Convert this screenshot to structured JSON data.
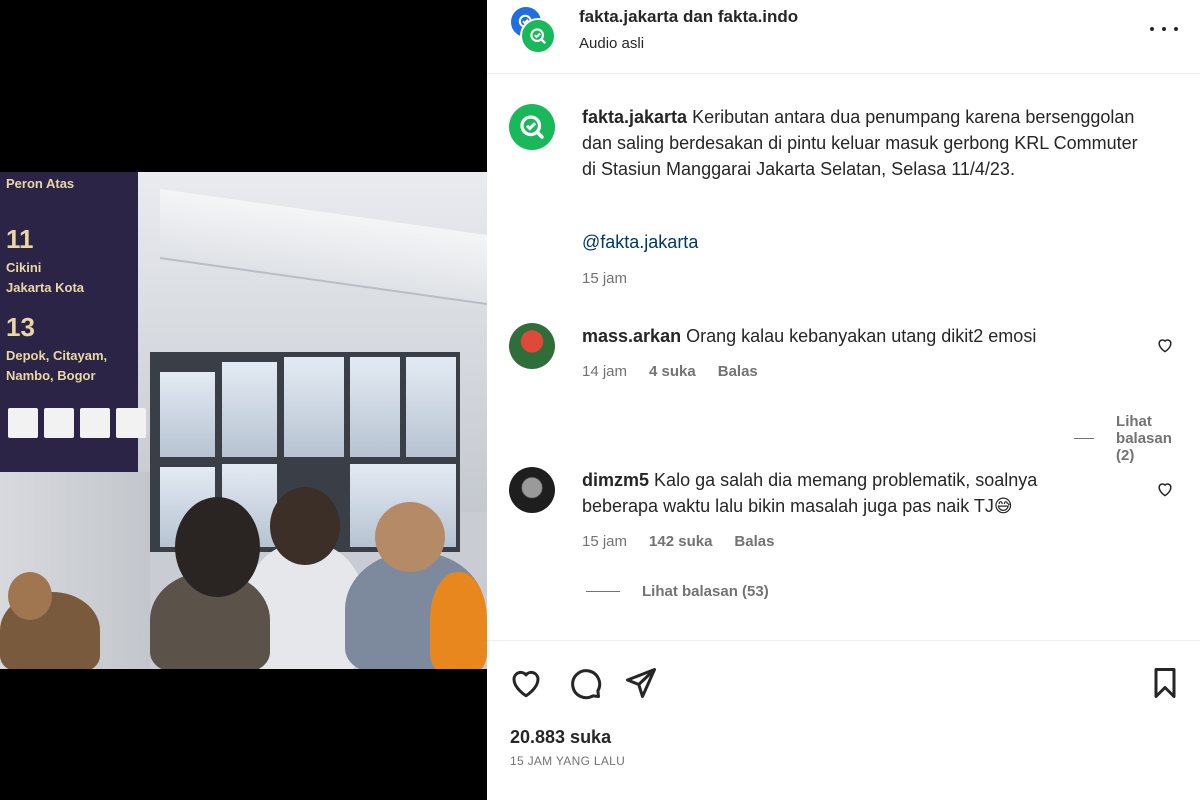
{
  "header": {
    "account_names": "fakta.jakarta dan fakta.indo",
    "audio": "Audio asli"
  },
  "caption": {
    "username": "fakta.jakarta",
    "text": "Keributan antara dua penumpang karena bersenggolan dan saling berdesakan di pintu keluar masuk gerbong KRL Commuter di Stasiun Manggarai Jakarta Selatan, Selasa 11/4/23.",
    "mention": "@fakta.jakarta",
    "time": "15 jam"
  },
  "comments": [
    {
      "username": "mass.arkan",
      "text": "Orang kalau kebanyakan utang dikit2 emosi",
      "time": "14 jam",
      "likes": "4 suka",
      "reply_label": "Balas",
      "view_replies": "Lihat balasan (2)"
    },
    {
      "username": "dimzm5",
      "text": "Kalo ga salah dia memang problematik, soalnya beberapa waktu lalu bikin masalah juga pas naik TJ😅",
      "time": "15 jam",
      "likes": "142 suka",
      "reply_label": "Balas",
      "view_replies": "Lihat balasan (53)"
    }
  ],
  "stats": {
    "likes": "20.883 suka",
    "posted": "15 JAM YANG LALU"
  },
  "video_sign": {
    "line1": "Peron Atas",
    "line2": "11",
    "line3": "Cikini",
    "line4": "Jakarta Kota",
    "line5": "13",
    "line6": "Depok, Citayam,",
    "line7": "Nambo, Bogor"
  },
  "icons": {
    "more": "more-horizontal-icon",
    "like": "heart-icon",
    "comment": "comment-bubble-icon",
    "share": "paper-plane-icon",
    "save": "bookmark-icon"
  },
  "colors": {
    "brand_green": "#19b85a",
    "brand_blue": "#1f6fe0",
    "mention_blue": "#00376b",
    "muted": "#737373"
  }
}
